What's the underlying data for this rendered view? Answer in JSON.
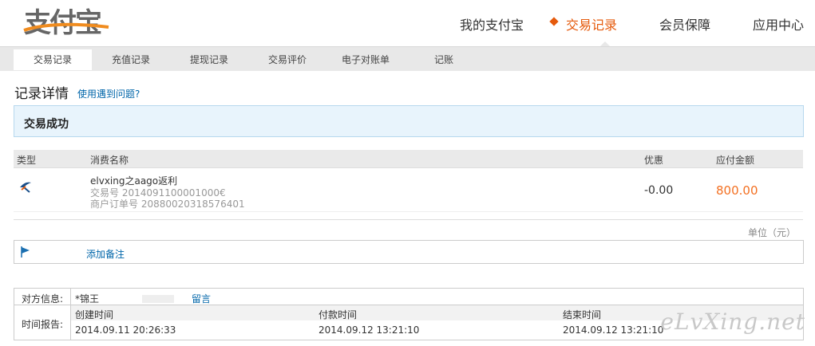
{
  "brand": {
    "logo_text": "支付宝"
  },
  "topnav": [
    {
      "label": "我的支付宝"
    },
    {
      "label": "交易记录",
      "active": true
    },
    {
      "label": "会员保障"
    },
    {
      "label": "应用中心"
    }
  ],
  "subnav": [
    {
      "label": "交易记录",
      "active": true
    },
    {
      "label": "充值记录"
    },
    {
      "label": "提现记录"
    },
    {
      "label": "交易评价"
    },
    {
      "label": "电子对账单"
    },
    {
      "label": "记账"
    }
  ],
  "page": {
    "title": "记录详情",
    "help_link": "使用遇到问题?"
  },
  "status": {
    "text": "交易成功"
  },
  "table": {
    "headers": {
      "type": "类型",
      "name": "消费名称",
      "discount": "优惠",
      "amount": "应付金额"
    },
    "row": {
      "name": "elvxing之aago返利",
      "trade_no": "交易号 2014091100001000€",
      "order_no": "商户订单号 20880020318576401",
      "discount": "-0.00",
      "amount": "800.00"
    }
  },
  "unit": "单位（元）",
  "note": {
    "add_label": "添加备注"
  },
  "info": {
    "counterparty_label": "对方信息:",
    "counterparty_value": "*锦王",
    "message_link": "留言",
    "time_label": "时间报告:",
    "created_label": "创建时间",
    "paid_label": "付款时间",
    "ended_label": "结束时间",
    "created": "2014.09.11 20:26:33",
    "paid": "2014.09.12 13:21:10",
    "ended": "2014.09.12 13:21:10"
  },
  "watermark": "eLvXing.net",
  "colors": {
    "accent": "#e55a0c",
    "amount": "#f37022",
    "link": "#0066aa",
    "status_bg": "#e8f4fc"
  }
}
